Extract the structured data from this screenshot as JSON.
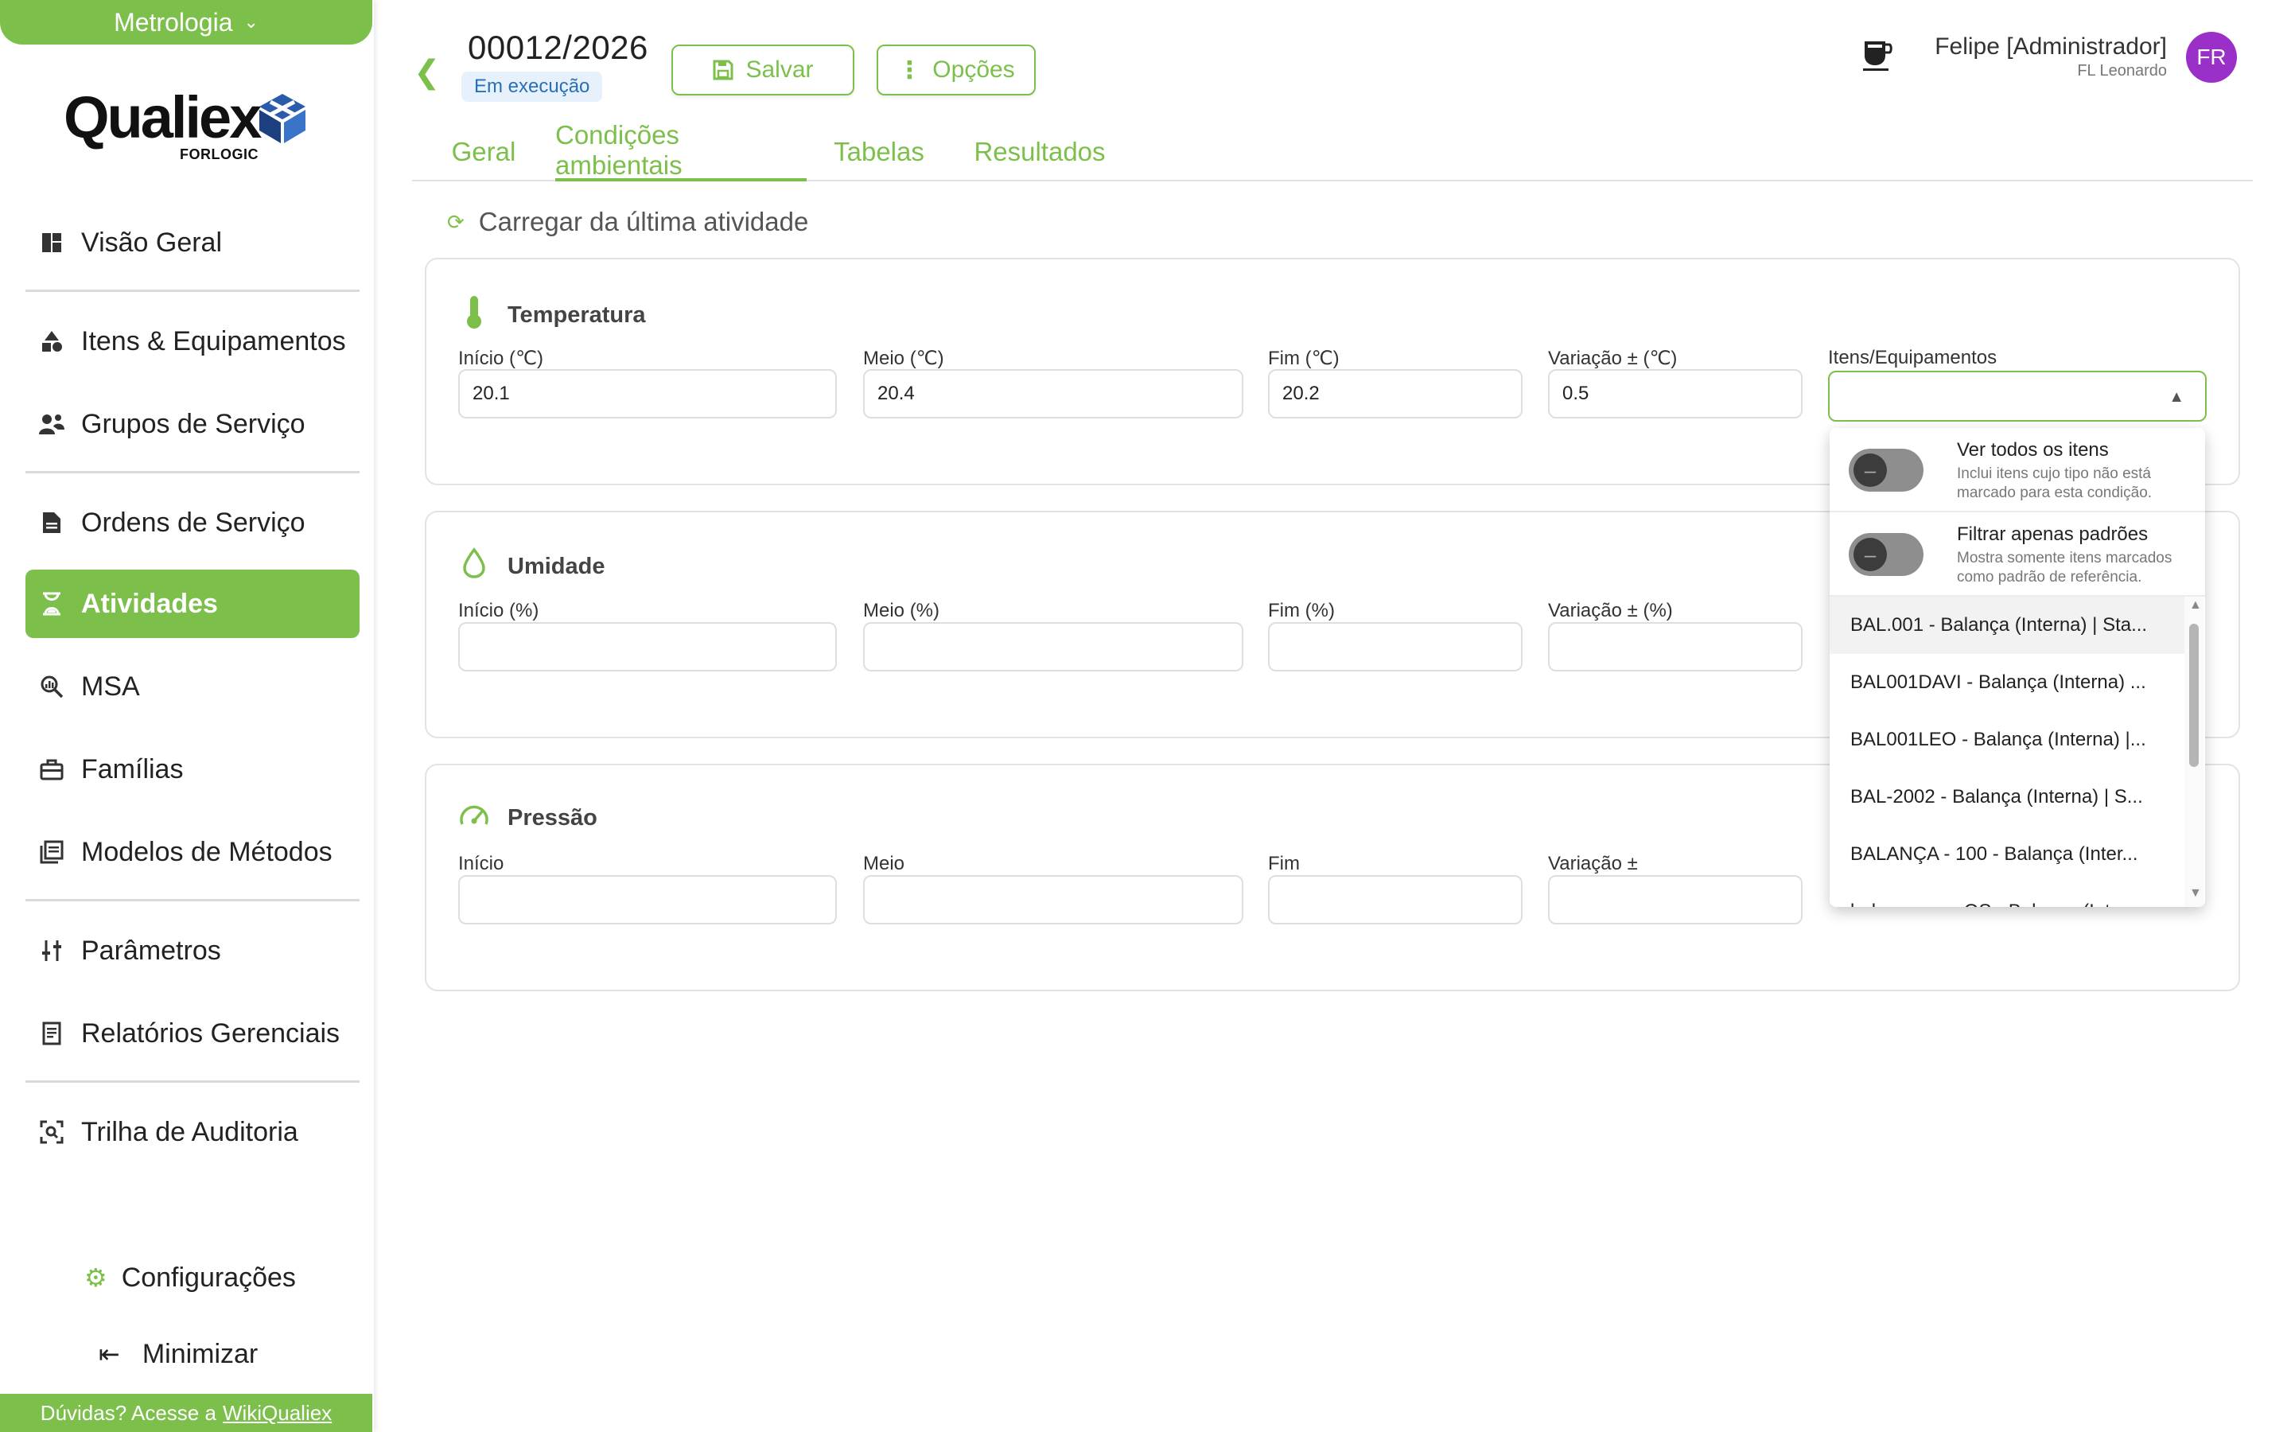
{
  "module": {
    "label": "Metrologia"
  },
  "logo": {
    "word": "Qualiex",
    "sub": "FORLOGIC"
  },
  "sidebar": {
    "items": [
      {
        "label": "Visão Geral",
        "icon": "dashboard-icon"
      },
      {
        "label": "Itens & Equipamentos",
        "icon": "shapes-icon"
      },
      {
        "label": "Grupos de Serviço",
        "icon": "user-group-icon"
      },
      {
        "label": "Ordens de Serviço",
        "icon": "document-icon"
      },
      {
        "label": "Atividades",
        "icon": "hourglass-icon"
      },
      {
        "label": "MSA",
        "icon": "magnify-chart-icon"
      },
      {
        "label": "Famílias",
        "icon": "toolbox-icon"
      },
      {
        "label": "Modelos de Métodos",
        "icon": "library-icon"
      },
      {
        "label": "Parâmetros",
        "icon": "sliders-icon"
      },
      {
        "label": "Relatórios Gerenciais",
        "icon": "report-icon"
      },
      {
        "label": "Trilha de Auditoria",
        "icon": "audit-icon"
      }
    ],
    "active": "Atividades",
    "config_label": "Configurações",
    "minimize_label": "Minimizar",
    "help_text": "Dúvidas? Acesse a",
    "help_link": "WikiQualiex"
  },
  "header": {
    "os_number": "00012/2026",
    "status": "Em execução",
    "save_label": "Salvar",
    "options_label": "Opções",
    "user_name": "Felipe [Administrador]",
    "user_company": "FL Leonardo",
    "avatar_initials": "FR"
  },
  "tabs": [
    {
      "label": "Geral"
    },
    {
      "label": "Condições ambientais",
      "active": true
    },
    {
      "label": "Tabelas"
    },
    {
      "label": "Resultados"
    }
  ],
  "reload_label": "Carregar da última atividade",
  "sections": {
    "temperatura": {
      "title": "Temperatura",
      "fields": [
        {
          "label": "Início (℃)",
          "value": "20.1"
        },
        {
          "label": "Meio (℃)",
          "value": "20.4"
        },
        {
          "label": "Fim (℃)",
          "value": "20.2"
        },
        {
          "label": "Variação ± (℃)",
          "value": "0.5"
        },
        {
          "label": "Itens/Equipamentos",
          "value": ""
        }
      ]
    },
    "umidade": {
      "title": "Umidade",
      "fields": [
        {
          "label": "Início (%)",
          "value": ""
        },
        {
          "label": "Meio (%)",
          "value": ""
        },
        {
          "label": "Fim (%)",
          "value": ""
        },
        {
          "label": "Variação ± (%)",
          "value": ""
        }
      ]
    },
    "pressao": {
      "title": "Pressão",
      "fields": [
        {
          "label": "Início",
          "value": ""
        },
        {
          "label": "Meio",
          "value": ""
        },
        {
          "label": "Fim",
          "value": ""
        },
        {
          "label": "Variação ±",
          "value": ""
        }
      ]
    }
  },
  "dropdown": {
    "toggles": [
      {
        "title": "Ver todos os itens",
        "desc": "Inclui itens cujo tipo não está marcado para esta condição.",
        "on": false
      },
      {
        "title": "Filtrar apenas padrões",
        "desc": "Mostra somente itens marcados como padrão de referência.",
        "on": false
      }
    ],
    "items": [
      "BAL.001 - Balança (Interna) | Sta...",
      "BAL001DAVI - Balança (Interna) ...",
      "BAL001LEO - Balança (Interna) |...",
      "BAL-2002 - Balança (Interna) | S...",
      "BALANÇA - 100 - Balança (Inter...",
      "balança com OS - Balança (Inter..."
    ]
  },
  "colors": {
    "brand": "#7cc04b",
    "avatar": "#9b30c9",
    "badge_bg": "#e6f1fb",
    "badge_text": "#2a6fb5"
  }
}
